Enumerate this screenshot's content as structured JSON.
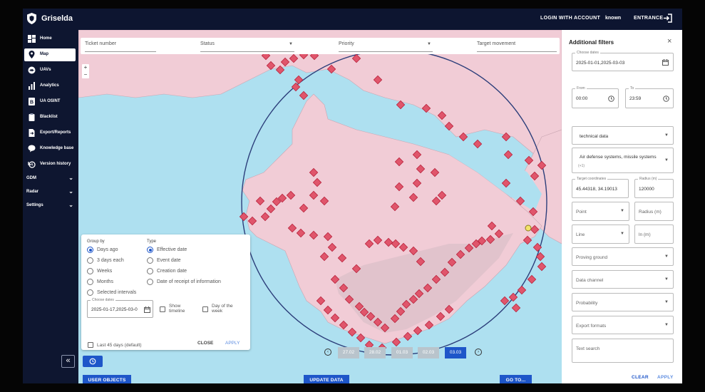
{
  "app": {
    "brand": "Griselda"
  },
  "topbar": {
    "login_label": "LOGIN WITH ACCOUNT",
    "user_label": "known",
    "entrance_label": "ENTRANCE"
  },
  "sidebar": {
    "items": [
      {
        "label": "Home",
        "icon": "dashboard-icon"
      },
      {
        "label": "Map",
        "icon": "map-pin-icon",
        "active": true
      },
      {
        "label": "UAVs",
        "icon": "drone-icon"
      },
      {
        "label": "Analytics",
        "icon": "bar-chart-icon"
      },
      {
        "label": "UA OSINT",
        "icon": "osint-icon"
      },
      {
        "label": "Blacklist",
        "icon": "clipboard-icon"
      },
      {
        "label": "Export/Reports",
        "icon": "file-export-icon"
      },
      {
        "label": "Knowledge base",
        "icon": "chat-bubble-icon"
      },
      {
        "label": "Version history",
        "icon": "history-icon"
      }
    ],
    "sections": [
      {
        "label": "GDM"
      },
      {
        "label": "Radar"
      },
      {
        "label": "Settings"
      }
    ]
  },
  "filterbar": {
    "ticket": "Ticket number",
    "status": "Status",
    "priority": "Priority",
    "movement": "Target movement"
  },
  "group_panel": {
    "group_by_label": "Group by",
    "type_label": "Type",
    "group_options": [
      "Days ago",
      "3 days each",
      "Weeks",
      "Months",
      "Selected intervals"
    ],
    "group_selected": "Days ago",
    "type_options": [
      "Effective date",
      "Event date",
      "Creation date",
      "Date of receipt of information"
    ],
    "type_selected": "Effective date",
    "choose_dates_label": "Choose dates",
    "dates_value": "2025-01-17,2025-03-0",
    "show_timeline": "Show timeline",
    "day_of_week": "Day of the week",
    "last45": "Last 45 days (default)",
    "close": "CLOSE",
    "apply": "APPLY"
  },
  "timeline": {
    "dates": [
      "27.02",
      "28.02",
      "01.03",
      "02.03",
      "03.03"
    ],
    "selected": "03.03"
  },
  "bottom": {
    "user_objects": "USER OBJECTS",
    "update_data": "UPDATE DATA",
    "goto": "GO TO..."
  },
  "filters": {
    "title": "Additional filters",
    "choose_dates_label": "Choose dates",
    "dates_value": "2025-01-01,2025-03-03",
    "from_label": "From",
    "from_value": "00:00",
    "to_label": "To",
    "to_value": "23:59",
    "technical_data": "technical data",
    "air_defense": "Air defense systems, missile systems",
    "air_defense_extra": "(+1)",
    "coords_label": "Target coordinates",
    "coords_value": "45.44318, 34.19013",
    "radius_label": "Radius (m)",
    "radius_value": "120000",
    "point": "Point",
    "radius_m": "Radius (m)",
    "line": "Line",
    "ln_m": "ln (m)",
    "proving_ground": "Proving ground",
    "data_channel": "Data channel",
    "probability": "Probability",
    "export_formats": "Export formats",
    "text_search": "Text search",
    "clear": "CLEAR",
    "apply": "APPLY"
  },
  "colors": {
    "navy": "#0e1630",
    "accent": "#1e56c9",
    "marker": "#e0556b",
    "land": "#f1ccd6",
    "sea": "#aee0f0"
  }
}
